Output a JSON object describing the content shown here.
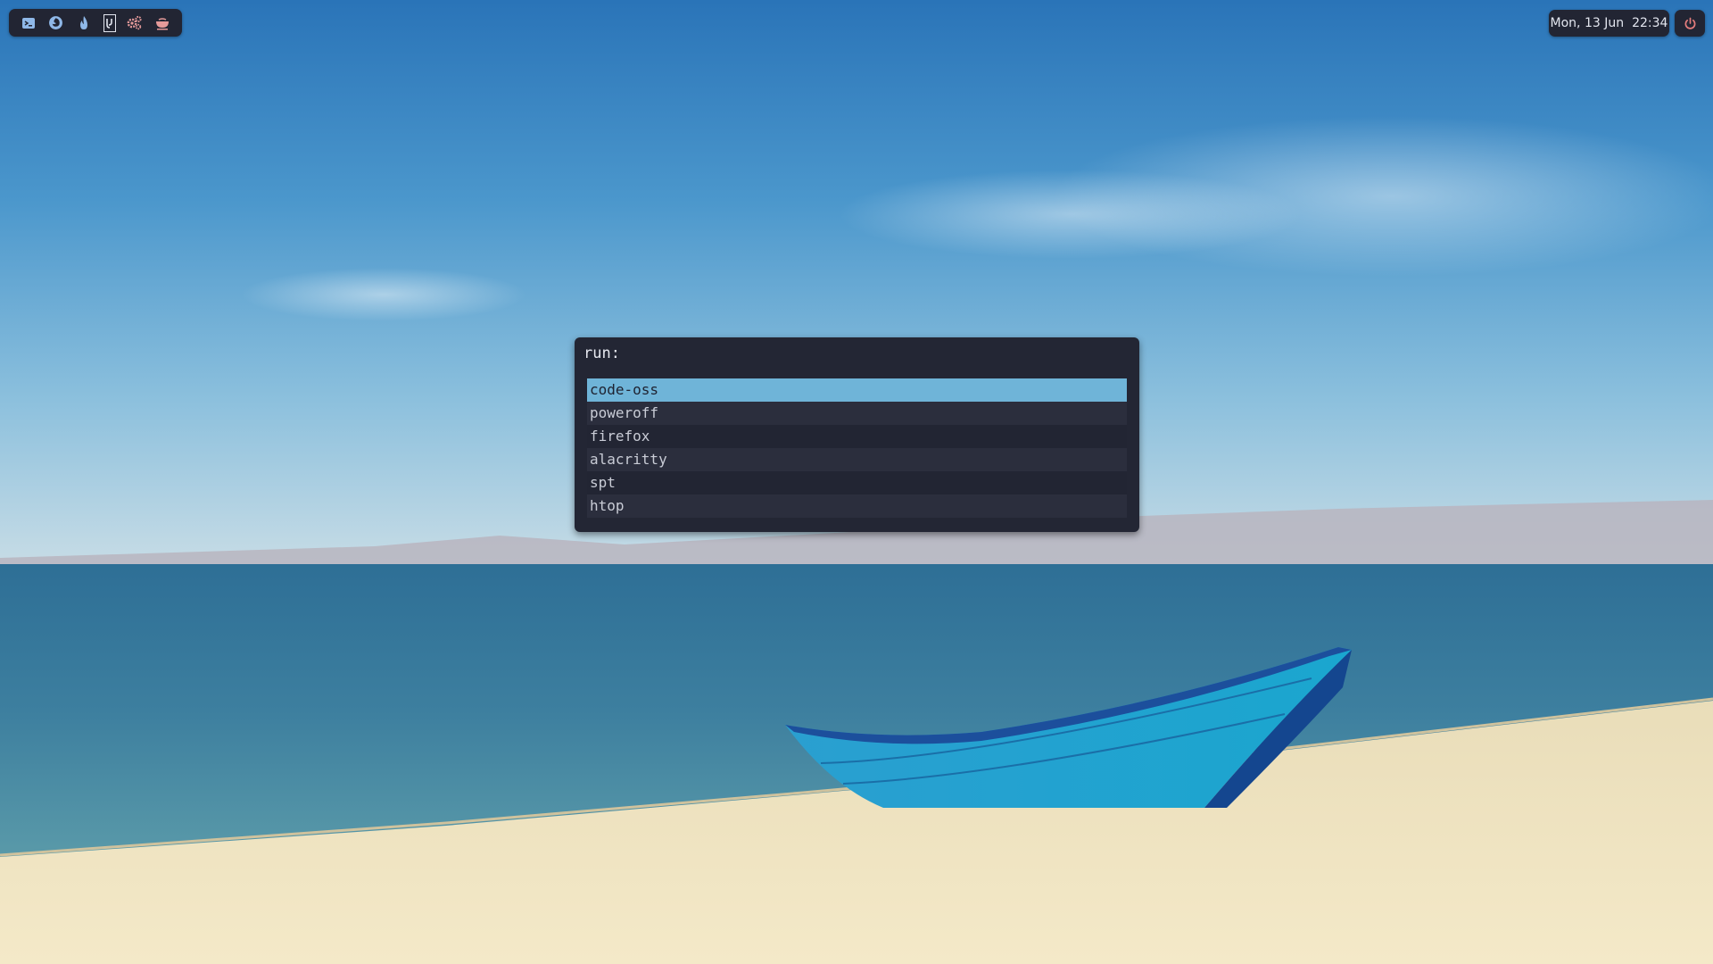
{
  "launcher": {
    "apps": [
      {
        "name": "terminal",
        "icon": "terminal-icon",
        "color": "#8fb8e8"
      },
      {
        "name": "firefox",
        "icon": "firefox-icon",
        "color": "#8fb8e8"
      },
      {
        "name": "fire",
        "icon": "flame-icon",
        "color": "#8fb8e8"
      },
      {
        "name": "editor",
        "icon": "code-editor-icon",
        "color": "#e3e6ef",
        "active": true
      },
      {
        "name": "settings",
        "icon": "gears-icon",
        "color": "#e59a9a"
      },
      {
        "name": "tea",
        "icon": "teapot-icon",
        "color": "#e59a9a"
      }
    ]
  },
  "clock": {
    "date": "Mon, 13 Jun",
    "time": "22:34"
  },
  "power": {
    "icon": "power-icon",
    "color": "#e37c7c"
  },
  "run": {
    "prompt": "run:",
    "value": "",
    "items": [
      "code-oss",
      "poweroff",
      "firefox",
      "alacritty",
      "spt",
      "htop"
    ],
    "selected_index": 0,
    "highlight_color": "#6fb4d8"
  }
}
